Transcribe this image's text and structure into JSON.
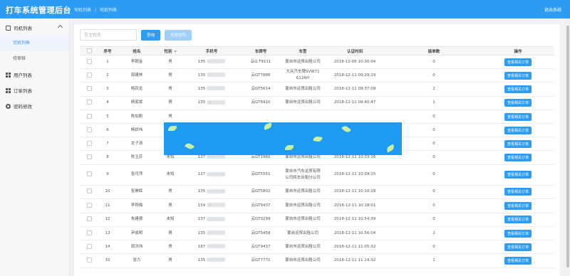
{
  "header": {
    "title": "打车系统管理后台",
    "breadcrumb": [
      "司机列表",
      "司机列表"
    ],
    "breadcrumb_sep": "/",
    "logout": "退出系统"
  },
  "sidebar": {
    "groups": [
      {
        "label": "司机列表",
        "icon": "car-icon",
        "children": [
          {
            "label": "司机列表",
            "active": true
          },
          {
            "label": "待审核",
            "active": false
          }
        ]
      },
      {
        "label": "用户列表",
        "icon": "grid-icon"
      },
      {
        "label": "订单列表",
        "icon": "grid-icon"
      },
      {
        "label": "密码修改",
        "icon": "gear-icon"
      }
    ]
  },
  "toolbar": {
    "search_placeholder": "车主姓名",
    "search_button": "查询",
    "batch_delete_button": "批量删除"
  },
  "table": {
    "columns": [
      "",
      "序号",
      "姓名",
      "性别",
      "手机号",
      "车牌号",
      "车型",
      "认证时间",
      "接单数",
      "操作"
    ],
    "action_label": "查看相关订单",
    "rows": [
      {
        "no": "1",
        "name": "李朝金",
        "gender": "男",
        "phone": "135",
        "plate": "云G.T9111",
        "model": "蒙自市运贸出租公司",
        "time": "2018-12-06 10:30:04",
        "orders": "0"
      },
      {
        "no": "2",
        "name": "周建林",
        "gender": "男",
        "phone": "135",
        "plate": "云GT7886",
        "model": "大众汽车牌SVW71612AH",
        "time": "2018-12-11 09:29:29",
        "orders": "0"
      },
      {
        "no": "3",
        "name": "杨跃龙",
        "gender": "男",
        "phone": "135",
        "plate": "云GT5614",
        "model": "蒙自市运贸出租公司",
        "time": "2018-12-11 09:37:09",
        "orders": "2"
      },
      {
        "no": "4",
        "name": "杨家斌",
        "gender": "男",
        "phone": "135",
        "plate": "云GT6910",
        "model": "蒙自市运贸出租公司",
        "time": "2018-12-11 09:40:47",
        "orders": "1"
      },
      {
        "no": "5",
        "name": "陈如刚",
        "gender": "男",
        "phone": "",
        "plate": "",
        "model": "",
        "time": "",
        "orders": "0"
      },
      {
        "no": "6",
        "name": "杨娇伟",
        "gender": "男",
        "phone": "",
        "plate": "",
        "model": "",
        "time": "",
        "orders": "0"
      },
      {
        "no": "7",
        "name": "龙子清",
        "gender": "男",
        "phone": "",
        "plate": "",
        "model": "",
        "time": "",
        "orders": "0"
      },
      {
        "no": "8",
        "name": "陈玉芬",
        "gender": "未知",
        "phone": "137",
        "plate": "云GT1960",
        "model": "蒙自市运贸出租公司",
        "time": "2018-12-11 10:03:16",
        "orders": "0"
      },
      {
        "no": "9",
        "name": "张月萍",
        "gender": "未知",
        "phone": "137",
        "plate": "云GT5551",
        "model": "蒙自市汽车运贸有限公司辉车出租分公司",
        "time": "2018-12-11 10:09:15",
        "orders": "0"
      },
      {
        "no": "10",
        "name": "张琳辉",
        "gender": "男",
        "phone": "135",
        "plate": "云GT5802",
        "model": "蒙自市运贸出租公司",
        "time": "2018-12-11 10:10:18",
        "orders": "0"
      },
      {
        "no": "11",
        "name": "李艳梅",
        "gender": "男",
        "phone": "159",
        "plate": "云GT9437",
        "model": "蒙自市运贸出租公司",
        "time": "2018-12-11 10:18:01",
        "orders": "0"
      },
      {
        "no": "12",
        "name": "朱建德",
        "gender": "未知",
        "phone": "137",
        "plate": "云GT3299",
        "model": "蒙自市运贸出租公司",
        "time": "2018-12-11 10:54:39",
        "orders": "0"
      },
      {
        "no": "13",
        "name": "尹成明",
        "gender": "男",
        "phone": "135",
        "plate": "云GT5458",
        "model": "蒙自运贸出租公司",
        "time": "2018-12-11 10:56:04",
        "orders": "2"
      },
      {
        "no": "14",
        "name": "周洪伟",
        "gender": "男",
        "phone": "187",
        "plate": "云GT9437",
        "model": "蒙自市运贸出租公司",
        "time": "2018-12-11 11:05:32",
        "orders": "0"
      },
      {
        "no": "15",
        "name": "张力",
        "gender": "男",
        "phone": "135",
        "plate": "云GT7771",
        "model": "蒙自市运贸出租公司",
        "time": "2018-12-11 11:14:32",
        "orders": "1"
      }
    ]
  },
  "colors": {
    "accent": "#2f9cf3",
    "overlay": "#1e9bf0"
  }
}
